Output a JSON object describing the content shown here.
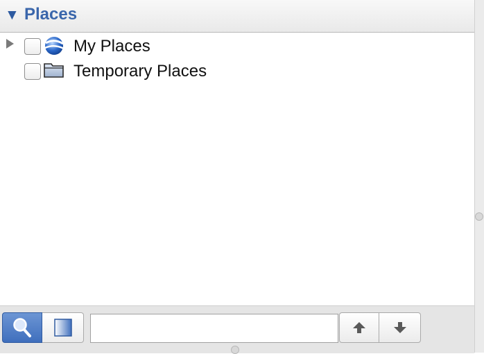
{
  "header": {
    "title": "Places",
    "collapse_icon": "disclosure-triangle-down-icon"
  },
  "tree": {
    "items": [
      {
        "label": "My Places",
        "icon": "earth-globe-icon",
        "expandable": true,
        "checked": false
      },
      {
        "label": "Temporary Places",
        "icon": "folder-icon",
        "expandable": false,
        "checked": false
      }
    ]
  },
  "toolbar": {
    "search_toggle_icon": "magnifier-icon",
    "panel_toggle_icon": "panel-icon",
    "search_value": "",
    "move_up_icon": "arrow-up-icon",
    "move_down_icon": "arrow-down-icon"
  },
  "colors": {
    "header_accent": "#3a66ab",
    "selected_button": "#4f7fc8"
  }
}
